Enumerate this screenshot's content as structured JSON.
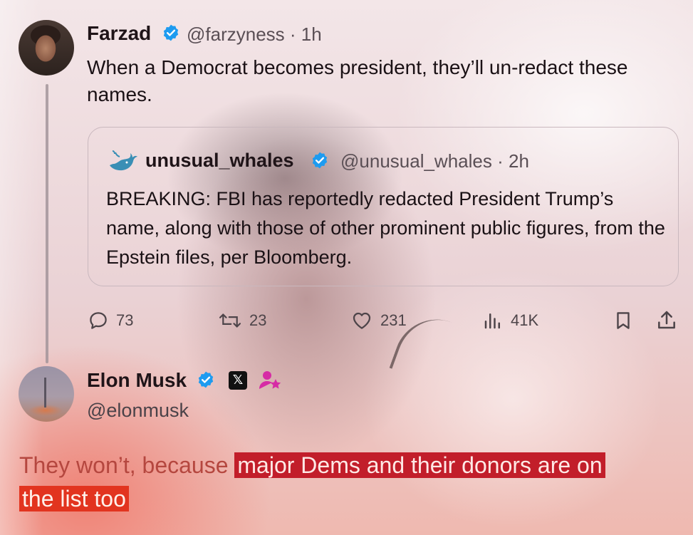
{
  "farzad_tweet": {
    "name": "Farzad",
    "handle": "@farzyness",
    "separator": "·",
    "time": "1h",
    "text": "When a Democrat becomes president, they’ll un-redact these names."
  },
  "quoted_tweet": {
    "name": "unusual_whales",
    "handle": "@unusual_whales",
    "separator": "·",
    "time": "2h",
    "text": "BREAKING: FBI has reportedly redacted President Trump’s name, along with those of other prominent public figures, from the Epstein files, per Bloomberg."
  },
  "actions": {
    "replies": "73",
    "reposts": "23",
    "likes": "231",
    "views": "41K"
  },
  "elon_tweet": {
    "name": "Elon Musk",
    "handle": "@elonmusk",
    "x_badge": "𝕏",
    "text_plain": "They won’t, because ",
    "text_highlight_1": "major Dems and their donors are on",
    "text_highlight_2": "the list too"
  },
  "colors": {
    "verified_blue": "#1d9bf0",
    "highlight_red": "#c21e2a",
    "highlight_orange_red": "#e2341f",
    "reply_text": "#b5473f",
    "affiliate_pink": "#d62ba5"
  },
  "icons": [
    "verified-badge-icon",
    "whale-avatar-icon",
    "reply-icon",
    "repost-icon",
    "like-icon",
    "views-icon",
    "bookmark-icon",
    "share-icon",
    "x-logo-icon",
    "affiliate-icon"
  ]
}
